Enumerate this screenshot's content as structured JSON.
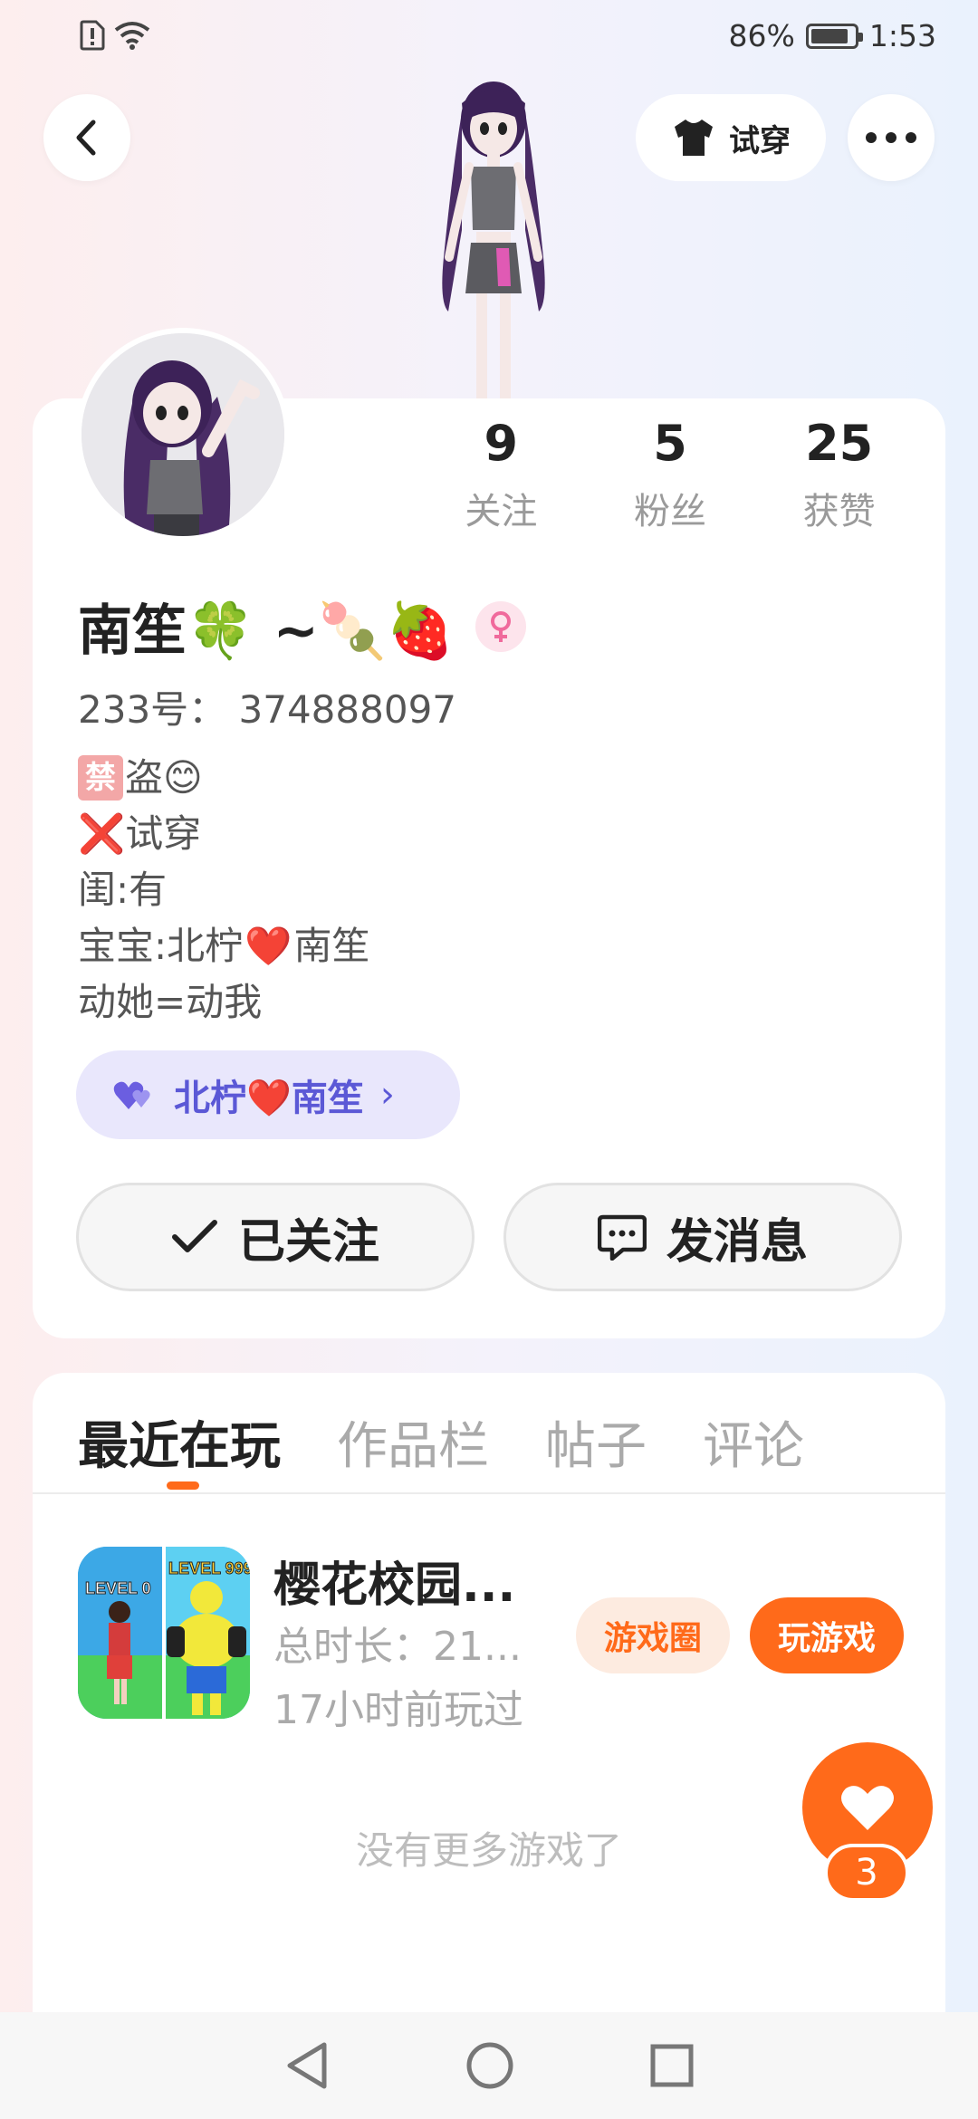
{
  "status_bar": {
    "battery": "86%",
    "time": "1:53",
    "battery_level": 0.86
  },
  "header": {
    "tryon_label": "试穿"
  },
  "stats": [
    {
      "num": "9",
      "label": "关注"
    },
    {
      "num": "5",
      "label": "粉丝"
    },
    {
      "num": "25",
      "label": "获赞"
    }
  ],
  "profile": {
    "nickname": "南笙🍀 ~🍡🍓",
    "uid": "233号： 374888097",
    "bio": {
      "line1_badge": "禁",
      "line1_text": "盗😊",
      "line2": "❌试穿",
      "line3": "闺:有",
      "line4_a": "宝宝:北柠",
      "line4_heart": "❤️",
      "line4_b": "南笙",
      "line5": "动她=动我"
    },
    "cp_badge": {
      "left": "北柠",
      "heart": "❤️",
      "right": "南笙",
      "arrow": "›"
    }
  },
  "actions": {
    "follow_label": "已关注",
    "message_label": "发消息"
  },
  "tabs": [
    "最近在玩",
    "作品栏",
    "帖子",
    "评论"
  ],
  "game": {
    "title": "樱花校园...",
    "duration": "总时长：21...",
    "last_played": "17小时前玩过",
    "circle_label": "游戏圈",
    "play_label": "玩游戏",
    "icon_text_left": "LEVEL 0",
    "icon_text_right": "LEVEL 999"
  },
  "no_more_text": "没有更多游戏了",
  "fab": {
    "count": "3"
  },
  "colors": {
    "accent": "#ff6a1a",
    "cp_bg": "#e9e7fc",
    "cp_text": "#5b58d6"
  }
}
